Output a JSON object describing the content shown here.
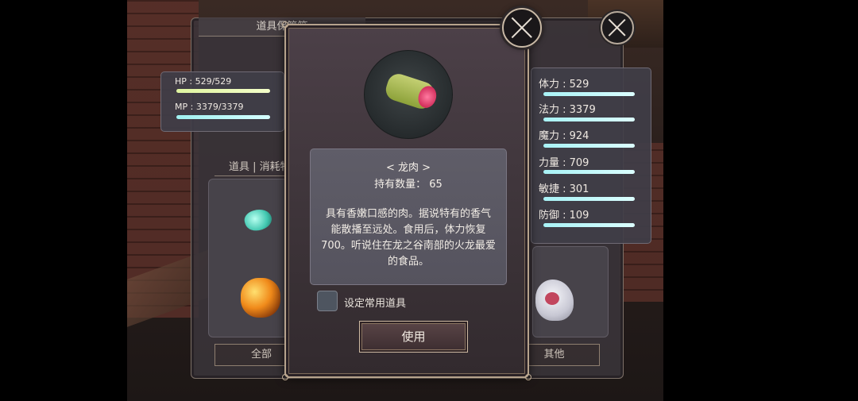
{
  "back_panel": {
    "title": "道具保管箱",
    "left_stats": {
      "hp": {
        "label": "HP : 529/529",
        "fill": 1.0
      },
      "mp": {
        "label": "MP : 3379/3379",
        "fill": 1.0
      }
    },
    "category_tab": "道具 | 消耗物",
    "usage_tab": "使用",
    "all_button": "全部",
    "other_button": "其他",
    "right_stats": [
      {
        "label": "体力 : 529"
      },
      {
        "label": "法力 : 3379"
      },
      {
        "label": "魔力 : 924"
      },
      {
        "label": "力量 : 709"
      },
      {
        "label": "敏捷 : 301"
      },
      {
        "label": "防御 : 109"
      }
    ]
  },
  "item_detail": {
    "name": "< 龙肉 >",
    "count_label": "持有数量：  65",
    "description": "具有香嫩口感的肉。据说特有的香气能散播至远处。食用后，体力恢复700。听说住在龙之谷南部的火龙最爱的食品。",
    "favorite_label": "设定常用道具",
    "favorite_checked": false,
    "use_button": "使用"
  },
  "icons": {
    "close": "close-icon",
    "item": "dragon-meat-icon"
  }
}
